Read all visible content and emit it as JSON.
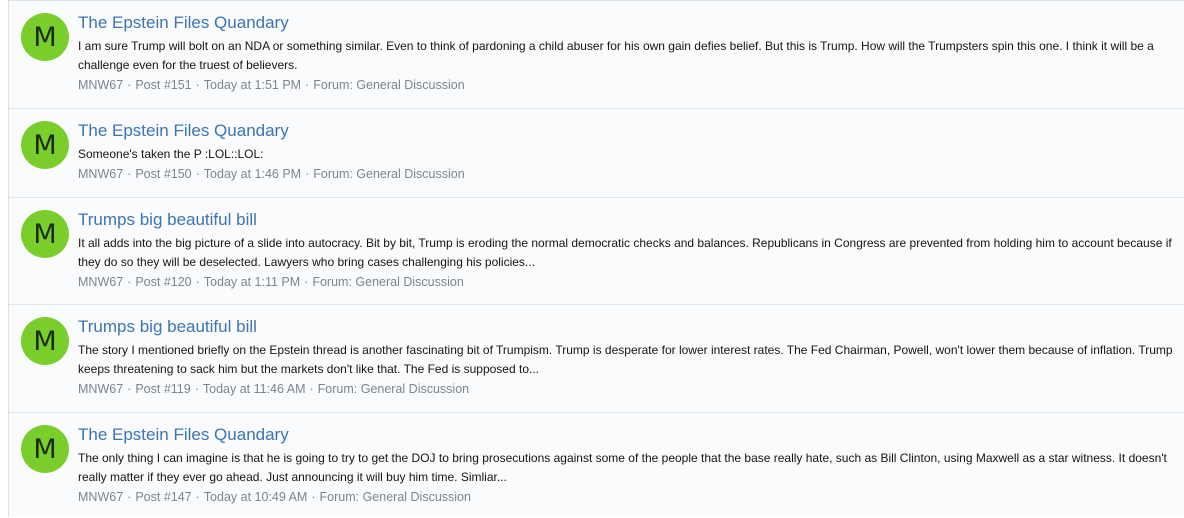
{
  "results": [
    {
      "avatar_letter": "M",
      "title": "The Epstein Files Quandary",
      "snippet": "I am sure Trump will bolt on an NDA or something similar. Even to think of pardoning a child abuser for his own gain defies belief. But this is Trump. How will the Trumpsters spin this one. I think it will be a challenge even for the truest of believers.",
      "author": "MNW67",
      "post": "Post #151",
      "time": "Today at 1:51 PM",
      "forum": "Forum: General Discussion"
    },
    {
      "avatar_letter": "M",
      "title": "The Epstein Files Quandary",
      "snippet": "Someone's taken the P :LOL::LOL:",
      "author": "MNW67",
      "post": "Post #150",
      "time": "Today at 1:46 PM",
      "forum": "Forum: General Discussion"
    },
    {
      "avatar_letter": "M",
      "title": "Trumps big beautiful bill",
      "snippet": "It all adds into the big picture of a slide into autocracy. Bit by bit, Trump is eroding the normal democratic checks and balances. Republicans in Congress are prevented from holding him to account because if they do so they will be deselected. Lawyers who bring cases challenging his policies...",
      "author": "MNW67",
      "post": "Post #120",
      "time": "Today at 1:11 PM",
      "forum": "Forum: General Discussion"
    },
    {
      "avatar_letter": "M",
      "title": "Trumps big beautiful bill",
      "snippet": "The story I mentioned briefly on the Epstein thread is another fascinating bit of Trumpism. Trump is desperate for lower interest rates. The Fed Chairman, Powell, won't lower them because of inflation. Trump keeps threatening to sack him but the markets don't like that. The Fed is supposed to...",
      "author": "MNW67",
      "post": "Post #119",
      "time": "Today at 11:46 AM",
      "forum": "Forum: General Discussion"
    },
    {
      "avatar_letter": "M",
      "title": "The Epstein Files Quandary",
      "snippet": "The only thing I can imagine is that he is going to try to get the DOJ to bring prosecutions against some of the people that the base really hate, such as Bill Clinton, using Maxwell as a star witness. It doesn't really matter if they ever go ahead. Just announcing it will buy him time. Simliar...",
      "author": "MNW67",
      "post": "Post #147",
      "time": "Today at 10:49 AM",
      "forum": "Forum: General Discussion"
    }
  ],
  "meta_separator": "·",
  "colors": {
    "avatar": "#7ace2b",
    "title_link": "#3c74b2",
    "meta_text": "#7a8591",
    "row_background": "#fafbfc"
  }
}
